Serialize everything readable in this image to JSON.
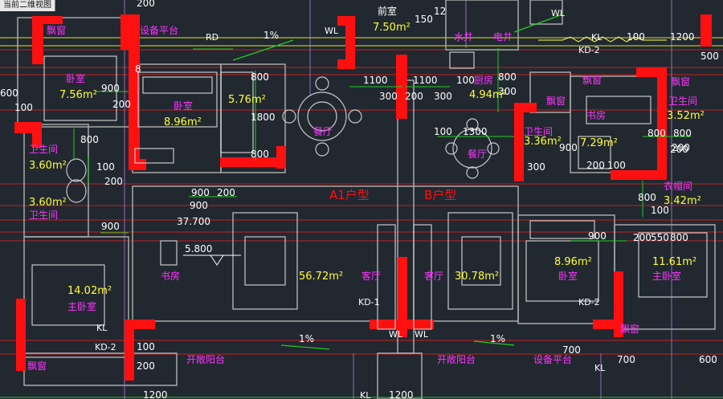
{
  "drawing_tab": "当前二维视图",
  "texts": {
    "bay_window": "飘窗",
    "equipment_platform": "设备平台",
    "front_room": "前室",
    "front_room_area": "7.50m²",
    "water_well": "水井",
    "electric_well": "电井",
    "bedroom": "卧室",
    "bedroom_left_area": "7.56m²",
    "bedroom_mid_area": "8.96m²",
    "store_area": "5.76m²",
    "dining": "餐厅",
    "kitchen": "厨房",
    "kitchen_area": "4.94m²",
    "study": "书房",
    "bath": "卫生间",
    "bath_left_area": "3.60m²",
    "bath_right_area": "3.36m²",
    "study_right_area": "7.29m²",
    "bath_far_right_area": "3.52m²",
    "wardrobe": "衣帽间",
    "wardrobe_area": "3.42m²",
    "unit_a": "A1户型",
    "unit_b": "B户型",
    "living": "客厅",
    "living_a_area": "56.72m²",
    "living_b_area": "30.78m²",
    "master_bedroom": "主卧室",
    "master_left_area": "14.02m²",
    "bedroom_right_area": "8.96m²",
    "master_right_area": "11.61m²",
    "open_balcony": "开敞阳台",
    "elev_1": "37.700",
    "elev_2": "5.800",
    "slope": "1%",
    "rd": "RD",
    "wl": "WL",
    "kl": "KL",
    "kd1": "KD-1",
    "kd2": "KD-2"
  },
  "dims": [
    "900",
    "200",
    "800",
    "1800",
    "1100",
    "300",
    "1300",
    "100",
    "600",
    "1200",
    "500",
    "550",
    "700",
    "150",
    "12",
    "8",
    "200"
  ],
  "colors": {
    "background": "#212830",
    "wall_red": "#ff1010",
    "room_label": "#ff33ff",
    "area_label": "#ffff33",
    "dimension_text": "#ffffff",
    "dimension_line": "#22cc22",
    "axis_line": "#c81e1e",
    "furniture": "#c9c9c9"
  }
}
